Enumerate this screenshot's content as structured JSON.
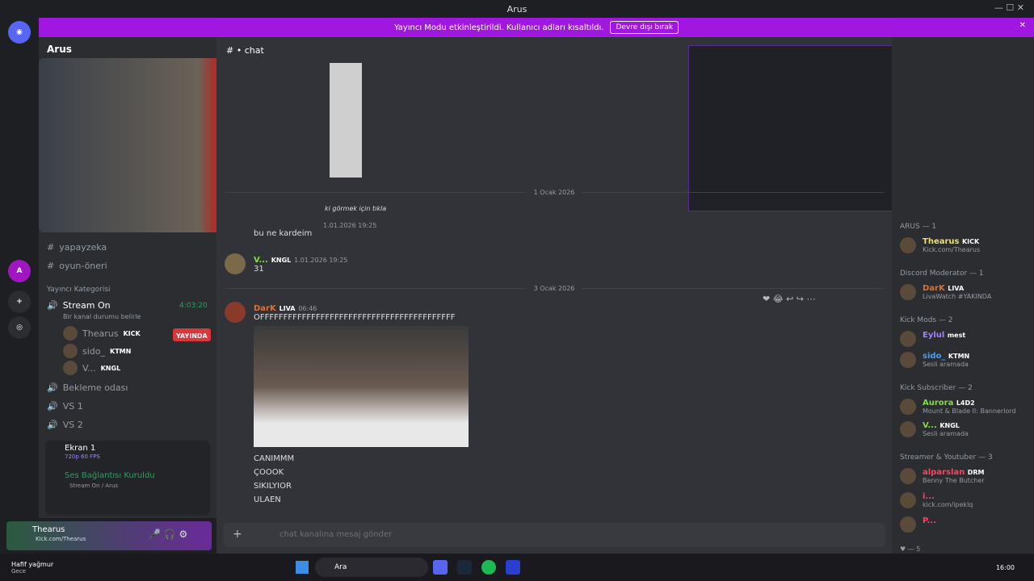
{
  "window": {
    "title": "Arus"
  },
  "banner": {
    "text": "Yayıncı Modu etkinleştirildi. Kullanıcı adları kısaltıldı.",
    "button": "Devre dışı bırak"
  },
  "server": {
    "name": "Arus"
  },
  "channels": {
    "items": [
      {
        "name": "yapayzeka"
      },
      {
        "name": "oyun-öneri"
      }
    ],
    "category": "Yayıncı Kategorisi",
    "voice": {
      "name": "Stream On",
      "time": "4:03:20",
      "status": "Bir kanal durumu belirle"
    },
    "voice_users": [
      {
        "name": "Thearus",
        "tag": "KICK",
        "live": "YAYINDA"
      },
      {
        "name": "sido_",
        "tag": "KTMN"
      },
      {
        "name": "V...",
        "tag": "KNGL"
      }
    ],
    "other_voice": [
      "Bekleme odası",
      "VS 1",
      "VS 2"
    ]
  },
  "screenshare": {
    "title": "Ekran 1",
    "quality": "720p 60 FPS"
  },
  "connection": {
    "status": "Ses Bağlantısı Kuruldu",
    "channel": "Stream On / Arus"
  },
  "user": {
    "name": "Thearus",
    "status": "Kick.com/Thearus"
  },
  "chat": {
    "channel": "chat",
    "dates": [
      "1 Ocak 2026",
      "3 Ocak 2026"
    ],
    "snippets": {
      "click": "ki görmek için tıkla",
      "ts1": "1.01.2026 19:25",
      "text1": "bu ne kardeim"
    },
    "msg2": {
      "name": "V...",
      "tag": "KNGL",
      "time": "1.01.2026 19:25",
      "text": "31"
    },
    "msg3": {
      "name": "DarK",
      "tag": "LIVA",
      "time": "06:46",
      "text": "OFFFFFFFFFFFFFFFFFFFFFFFFFFFFFFFFFFFFFFFFFF",
      "lines": [
        "CANIMMM",
        "ÇOOOK",
        "SIKILYIOR",
        "ULAEN"
      ]
    },
    "input_placeholder": "chat kanalına mesaj gönder"
  },
  "members": {
    "groups": [
      {
        "title": "ARUS — 1",
        "members": [
          {
            "name": "Thearus",
            "tag": "KICK",
            "sub": "Kick.com/Thearus",
            "color": "#f0e060"
          }
        ]
      },
      {
        "title": "Discord Moderator — 1",
        "members": [
          {
            "name": "DarK",
            "tag": "LIVA",
            "sub": "LivaWatch #YAKINDA",
            "color": "#e07030"
          }
        ]
      },
      {
        "title": "Kick Mods — 2",
        "members": [
          {
            "name": "Eylul",
            "tag": "mest",
            "sub": "",
            "color": "#a080ff"
          },
          {
            "name": "sido_",
            "tag": "KTMN",
            "sub": "Sesli aramada",
            "color": "#40a0ff"
          }
        ]
      },
      {
        "title": "Kick Subscriber — 2",
        "members": [
          {
            "name": "Aurora",
            "tag": "L4D2",
            "sub": "Mount & Blade II: Bannerlord",
            "color": "#80e040"
          },
          {
            "name": "V...",
            "tag": "KNGL",
            "sub": "Sesli aramada",
            "color": "#80e040"
          }
        ]
      },
      {
        "title": "Streamer & Youtuber — 3",
        "members": [
          {
            "name": "alparslan",
            "tag": "DRM",
            "sub": "Benny The Butcher",
            "color": "#ff4060"
          },
          {
            "name": "i...",
            "tag": "",
            "sub": "kick.com/ipeklq",
            "color": "#ff4060"
          },
          {
            "name": "P...",
            "tag": "",
            "sub": "",
            "color": "#ff4060"
          }
        ]
      }
    ],
    "reaction_count": "5"
  },
  "taskbar": {
    "weather": "Hafif yağmur",
    "weather_sub": "Gece",
    "search": "Ara",
    "time": "16:00"
  }
}
